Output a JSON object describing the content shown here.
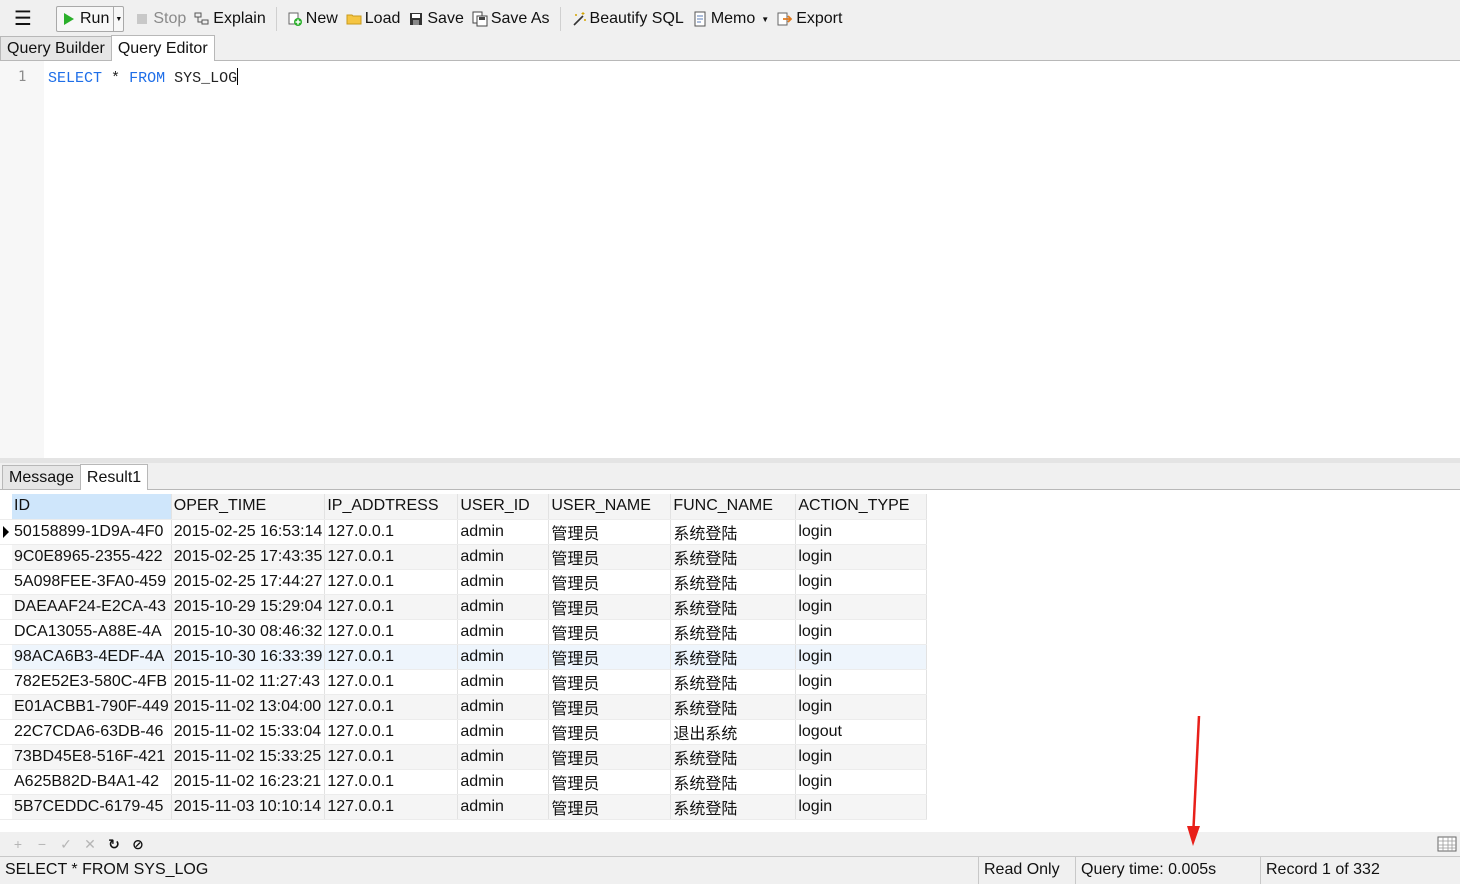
{
  "toolbar": {
    "run_label": "Run",
    "stop_label": "Stop",
    "explain_label": "Explain",
    "new_label": "New",
    "load_label": "Load",
    "save_label": "Save",
    "save_as_label": "Save As",
    "beautify_label": "Beautify SQL",
    "memo_label": "Memo",
    "export_label": "Export"
  },
  "tabs": [
    {
      "label": "Query Builder",
      "active": false
    },
    {
      "label": "Query Editor",
      "active": true
    }
  ],
  "editor": {
    "line_number": "1",
    "kw_select": "SELECT",
    "star": "*",
    "kw_from": "FROM",
    "table_name": "SYS_LOG"
  },
  "result_tabs": [
    {
      "label": "Message",
      "active": false
    },
    {
      "label": "Result1",
      "active": true
    }
  ],
  "grid": {
    "columns": [
      "ID",
      "OPER_TIME",
      "IP_ADDTRESS",
      "USER_ID",
      "USER_NAME",
      "FUNC_NAME",
      "ACTION_TYPE"
    ],
    "rows": [
      [
        "50158899-1D9A-4F0",
        "2015-02-25 16:53:14",
        "127.0.0.1",
        "admin",
        "管理员",
        "系统登陆",
        "login"
      ],
      [
        "9C0E8965-2355-422",
        "2015-02-25 17:43:35",
        "127.0.0.1",
        "admin",
        "管理员",
        "系统登陆",
        "login"
      ],
      [
        "5A098FEE-3FA0-459",
        "2015-02-25 17:44:27",
        "127.0.0.1",
        "admin",
        "管理员",
        "系统登陆",
        "login"
      ],
      [
        "DAEAAF24-E2CA-43",
        "2015-10-29 15:29:04",
        "127.0.0.1",
        "admin",
        "管理员",
        "系统登陆",
        "login"
      ],
      [
        "DCA13055-A88E-4A",
        "2015-10-30 08:46:32",
        "127.0.0.1",
        "admin",
        "管理员",
        "系统登陆",
        "login"
      ],
      [
        "98ACA6B3-4EDF-4A",
        "2015-10-30 16:33:39",
        "127.0.0.1",
        "admin",
        "管理员",
        "系统登陆",
        "login"
      ],
      [
        "782E52E3-580C-4FB",
        "2015-11-02 11:27:43",
        "127.0.0.1",
        "admin",
        "管理员",
        "系统登陆",
        "login"
      ],
      [
        "E01ACBB1-790F-449",
        "2015-11-02 13:04:00",
        "127.0.0.1",
        "admin",
        "管理员",
        "系统登陆",
        "login"
      ],
      [
        "22C7CDA6-63DB-46",
        "2015-11-02 15:33:04",
        "127.0.0.1",
        "admin",
        "管理员",
        "退出系统",
        "logout"
      ],
      [
        "73BD45E8-516F-421",
        "2015-11-02 15:33:25",
        "127.0.0.1",
        "admin",
        "管理员",
        "系统登陆",
        "login"
      ],
      [
        "A625B82D-B4A1-42",
        "2015-11-02 16:23:21",
        "127.0.0.1",
        "admin",
        "管理员",
        "系统登陆",
        "login"
      ],
      [
        "5B7CEDDC-6179-45",
        "2015-11-03 10:10:14",
        "127.0.0.1",
        "admin",
        "管理员",
        "系统登陆",
        "login"
      ]
    ]
  },
  "status": {
    "sql": "SELECT * FROM SYS_LOG",
    "mode": "Read Only",
    "query_time": "Query time: 0.005s",
    "record": "Record 1 of 332"
  },
  "colors": {
    "keyword": "#1e6ee8",
    "arrow": "#e8201a",
    "selected_header": "#cfe6fb"
  }
}
